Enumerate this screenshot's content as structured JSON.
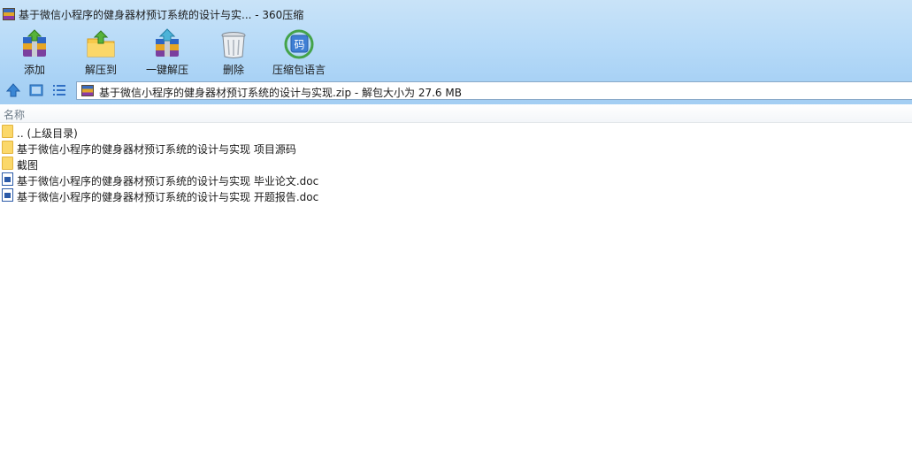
{
  "window": {
    "title": "基于微信小程序的健身器材预订系统的设计与实... - 360压缩"
  },
  "toolbar": {
    "buttons": [
      {
        "label": "添加",
        "icon": "add-archive-icon"
      },
      {
        "label": "解压到",
        "icon": "extract-to-icon"
      },
      {
        "label": "一键解压",
        "icon": "one-click-extract-icon"
      },
      {
        "label": "删除",
        "icon": "delete-icon"
      },
      {
        "label": "压缩包语言",
        "icon": "archive-language-icon"
      }
    ]
  },
  "nav": {
    "icons": [
      "up-arrow-icon",
      "thumbnail-view-icon",
      "list-view-icon"
    ]
  },
  "address": {
    "text": "基于微信小程序的健身器材预订系统的设计与实现.zip - 解包大小为 27.6 MB"
  },
  "columns": {
    "name": "名称"
  },
  "files": [
    {
      "label": ".. (上级目录)",
      "type": "folder"
    },
    {
      "label": "基于微信小程序的健身器材预订系统的设计与实现 项目源码",
      "type": "folder"
    },
    {
      "label": "截图",
      "type": "folder"
    },
    {
      "label": "基于微信小程序的健身器材预订系统的设计与实现 毕业论文.doc",
      "type": "doc"
    },
    {
      "label": "基于微信小程序的健身器材预订系统的设计与实现 开题报告.doc",
      "type": "doc"
    }
  ],
  "colors": {
    "toolbar_bg": "#a9d2f5",
    "folder": "#fbd86a",
    "doc_blue": "#2b5aa8"
  }
}
